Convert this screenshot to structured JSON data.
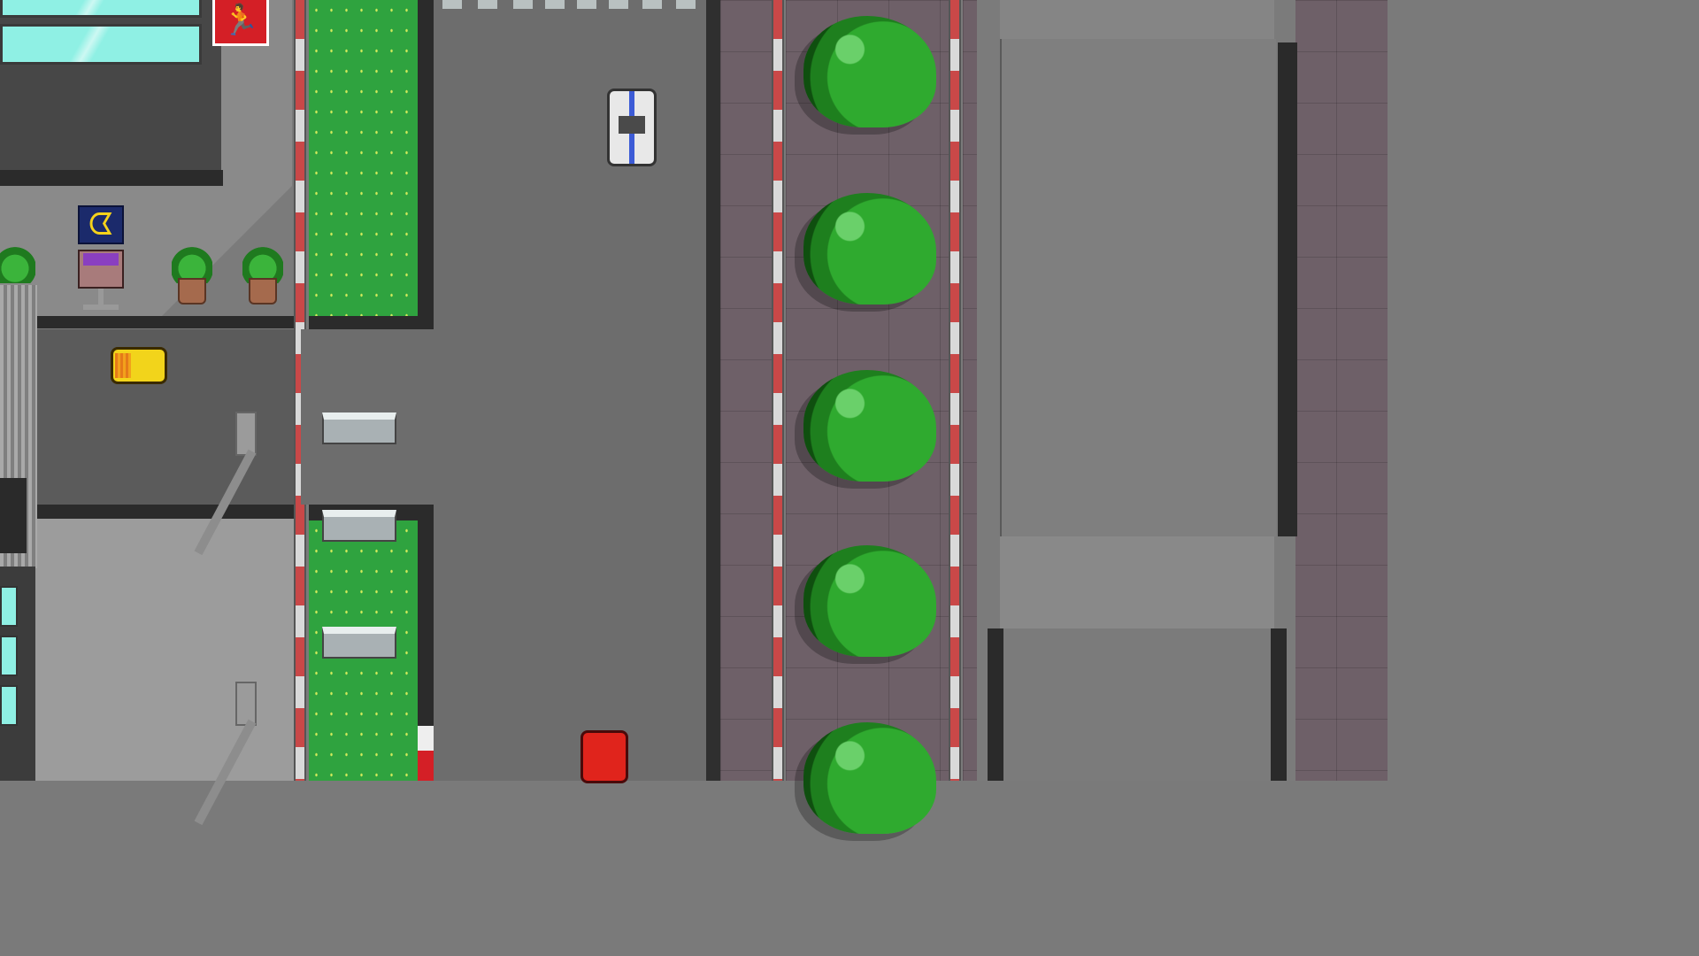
{
  "scene": {
    "title": "",
    "colors": {
      "grass": "#2fa33f",
      "road": "#6d6d6d",
      "curb_red": "#c94848",
      "plaza": "#6e6068",
      "glass": "#8ff0e4",
      "bush": "#2faa2f",
      "player_car": "#e8e8e8",
      "red_car": "#e0241c",
      "yellow_car": "#f2d41b"
    },
    "icons": {
      "pedestrian_sign": "running-man-icon",
      "arcade_logo": "pac-man-icon"
    },
    "glyphs": {
      "pedestrian": "🏃",
      "arcade": "ᗧ"
    }
  }
}
